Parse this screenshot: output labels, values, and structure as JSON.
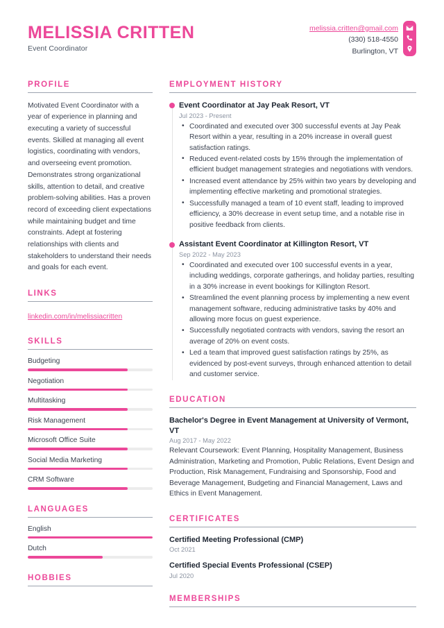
{
  "header": {
    "name": "MELISSIA CRITTEN",
    "job_title": "Event Coordinator",
    "contact": {
      "email": "melissia.critten@gmail.com",
      "phone": "(330) 518-4550",
      "location": "Burlington, VT"
    },
    "accent_color": "#ec4899"
  },
  "left": {
    "profile": {
      "title": "Profile",
      "text": "Motivated Event Coordinator with a year of experience in planning and executing a variety of successful events. Skilled at managing all event logistics, coordinating with vendors, and overseeing event promotion. Demonstrates strong organizational skills, attention to detail, and creative problem-solving abilities. Has a proven record of exceeding client expectations while maintaining budget and time constraints. Adept at fostering relationships with clients and stakeholders to understand their needs and goals for each event."
    },
    "links": {
      "title": "Links",
      "items": [
        {
          "label": "linkedin.com/in/melissiacritten"
        }
      ]
    },
    "skills": {
      "title": "Skills",
      "items": [
        {
          "label": "Budgeting",
          "level": 80
        },
        {
          "label": "Negotiation",
          "level": 80
        },
        {
          "label": "Multitasking",
          "level": 80
        },
        {
          "label": "Risk Management",
          "level": 80
        },
        {
          "label": "Microsoft Office Suite",
          "level": 80
        },
        {
          "label": "Social Media Marketing",
          "level": 80
        },
        {
          "label": "CRM Software",
          "level": 80
        }
      ]
    },
    "languages": {
      "title": "Languages",
      "items": [
        {
          "label": "English",
          "level": 100
        },
        {
          "label": "Dutch",
          "level": 60
        }
      ]
    },
    "hobbies": {
      "title": "Hobbies"
    }
  },
  "right": {
    "employment": {
      "title": "Employment History",
      "jobs": [
        {
          "heading": "Event Coordinator at Jay Peak Resort, VT",
          "date": "Jul 2023 - Present",
          "points": [
            "Coordinated and executed over 300 successful events at Jay Peak Resort within a year, resulting in a 20% increase in overall guest satisfaction ratings.",
            "Reduced event-related costs by 15% through the implementation of efficient budget management strategies and negotiations with vendors.",
            "Increased event attendance by 25% within two years by developing and implementing effective marketing and promotional strategies.",
            "Successfully managed a team of 10 event staff, leading to improved efficiency, a 30% decrease in event setup time, and a notable rise in positive feedback from clients."
          ]
        },
        {
          "heading": "Assistant Event Coordinator at Killington Resort, VT",
          "date": "Sep 2022 - May 2023",
          "points": [
            "Coordinated and executed over 100 successful events in a year, including weddings, corporate gatherings, and holiday parties, resulting in a 30% increase in event bookings for Killington Resort.",
            "Streamlined the event planning process by implementing a new event management software, reducing administrative tasks by 40% and allowing more focus on guest experience.",
            "Successfully negotiated contracts with vendors, saving the resort an average of 20% on event costs.",
            "Led a team that improved guest satisfaction ratings by 25%, as evidenced by post-event surveys, through enhanced attention to detail and customer service."
          ]
        }
      ]
    },
    "education": {
      "title": "Education",
      "entries": [
        {
          "title": "Bachelor's Degree in Event Management at University of Vermont, VT",
          "date": "Aug 2017 - May 2022",
          "description": "Relevant Coursework: Event Planning, Hospitality Management, Business Administration, Marketing and Promotion, Public Relations, Event Design and Production, Risk Management, Fundraising and Sponsorship, Food and Beverage Management, Budgeting and Financial Management, Laws and Ethics in Event Management."
        }
      ]
    },
    "certificates": {
      "title": "Certificates",
      "entries": [
        {
          "title": "Certified Meeting Professional (CMP)",
          "date": "Oct 2021"
        },
        {
          "title": "Certified Special Events Professional (CSEP)",
          "date": "Jul 2020"
        }
      ]
    },
    "memberships": {
      "title": "Memberships"
    }
  }
}
